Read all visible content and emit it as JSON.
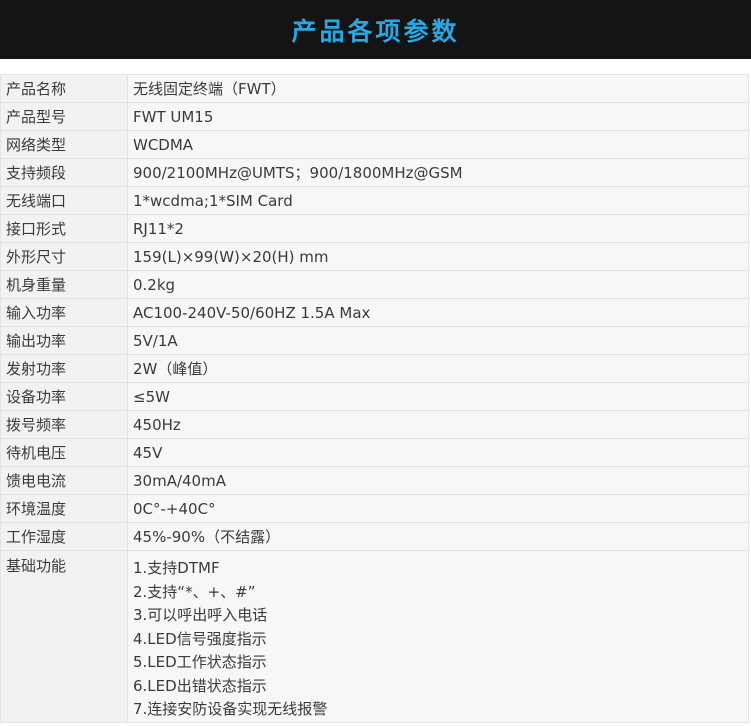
{
  "header": {
    "title": "产品各项参数"
  },
  "specs": [
    {
      "label": "产品名称",
      "value": "无线固定终端（FWT）"
    },
    {
      "label": "产品型号",
      "value": "FWT UM15"
    },
    {
      "label": "网络类型",
      "value": "WCDMA"
    },
    {
      "label": "支持频段",
      "value": "900/2100MHz@UMTS；900/1800MHz@GSM"
    },
    {
      "label": "无线端口",
      "value": "1*wcdma;1*SIM Card"
    },
    {
      "label": "接口形式",
      "value": "RJ11*2"
    },
    {
      "label": "外形尺寸",
      "value": "159(L)×99(W)×20(H) mm"
    },
    {
      "label": "机身重量",
      "value": "0.2kg"
    },
    {
      "label": "输入功率",
      "value": "AC100-240V-50/60HZ 1.5A Max"
    },
    {
      "label": "输出功率",
      "value": "5V/1A"
    },
    {
      "label": "发射功率",
      "value": "2W（峰值）"
    },
    {
      "label": "设备功率",
      "value": "≤5W"
    },
    {
      "label": "拨号频率",
      "value": "450Hz"
    },
    {
      "label": "待机电压",
      "value": "45V"
    },
    {
      "label": "馈电电流",
      "value": "30mA/40mA"
    },
    {
      "label": "环境温度",
      "value": "0C°-+40C°"
    },
    {
      "label": "工作湿度",
      "value": "45%-90%（不结露）"
    }
  ],
  "features": {
    "label": "基础功能",
    "items": [
      "1.支持DTMF",
      "2.支持“*、+、#”",
      "3.可以呼出呼入电话",
      "4.LED信号强度指示",
      "5.LED工作状态指示",
      "6.LED出错状态指示",
      "7.连接安防设备实现无线报警"
    ]
  }
}
